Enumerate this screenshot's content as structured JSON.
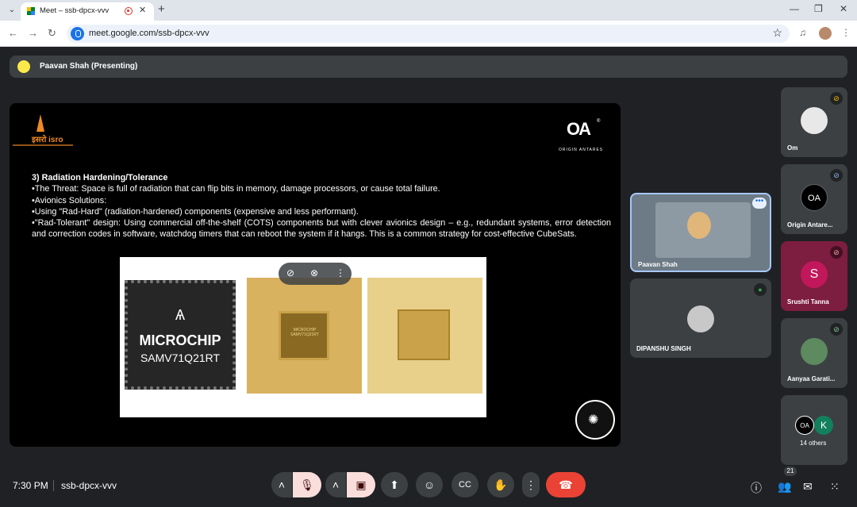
{
  "browser": {
    "tab_title": "Meet – ssb-dpcx-vvv",
    "url": "meet.google.com/ssb-dpcx-vvv",
    "icons": [
      "tab-list-icon",
      "meet-favicon",
      "recording-icon",
      "close-icon",
      "plus-icon",
      "minimize-icon",
      "restore-icon",
      "close-window-icon",
      "back-icon",
      "forward-icon",
      "reload-icon",
      "site-info-icon",
      "star-icon",
      "media-control-icon",
      "profile-avatar",
      "more-vert-icon"
    ]
  },
  "presenting": {
    "label": "Paavan Shah (Presenting)"
  },
  "slide": {
    "isro_logo_text": "इसरो isro",
    "brand_logo_text": "OA",
    "brand_caption": "ORIGIN ANTARES",
    "heading": "3) Radiation Hardening/Tolerance",
    "bullets": [
      "•The Threat: Space is full of radiation that can flip bits in memory, damage processors, or cause total failure.",
      "•Avionics Solutions:",
      "•Using \"Rad-Hard\" (radiation-hardened) components (expensive and less performant).",
      "•\"Rad-Tolerant\" design: Using commercial off-the-shelf (COTS) components but with clever avionics design – e.g., redundant systems, error detection and correction codes in software, watchdog timers that can reboot the system if it hangs. This is a common strategy for cost-effective CubeSats."
    ],
    "chip_brand": "MICROCHIP",
    "chip_part": "SAMV71Q21RT",
    "chip2_label": "MICROCHIP SAMV71Q21RT"
  },
  "participants": {
    "speaker": {
      "name": "Paavan Shah"
    },
    "second": {
      "name": "DIPANSHU SINGH"
    },
    "side": [
      {
        "name": "Om"
      },
      {
        "name": "Origin Antare..."
      },
      {
        "name": "Srushti Tanna",
        "initial": "S"
      },
      {
        "name": "Aanyaa Garati..."
      }
    ],
    "others": {
      "label": "14 others",
      "initial": "K"
    }
  },
  "meeting": {
    "time": "7:30 PM",
    "code": "ssb-dpcx-vvv",
    "people_count": "21"
  },
  "colors": {
    "accent_blue": "#1a73e8",
    "hangup_red": "#ea4335",
    "muted_pink": "#f9dedc",
    "presenter_yellow": "#fbe94a",
    "srushti_avatar": "#c2185b",
    "others_avatar": "#12805c"
  }
}
